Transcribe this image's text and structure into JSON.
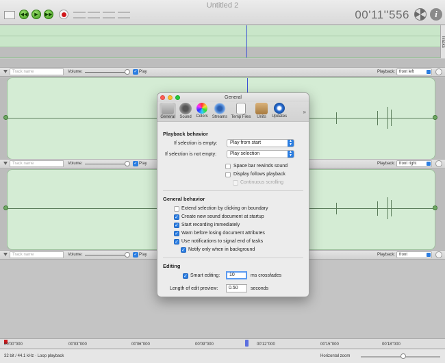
{
  "window": {
    "title": "Untitled 2"
  },
  "toolbar": {
    "timer": "00'11''556"
  },
  "overview": {
    "tracks_tab": "Tracks"
  },
  "tracks": [
    {
      "name_placeholder": "Track name",
      "volume_label": "Volume:",
      "play_label": "Play",
      "playback_label": "Playback:",
      "playback_value": "front left"
    },
    {
      "name_placeholder": "Track name",
      "volume_label": "Volume:",
      "play_label": "Play",
      "playback_label": "Playback:",
      "playback_value": "front right"
    },
    {
      "name_placeholder": "Track name",
      "volume_label": "Volume:",
      "play_label": "Play",
      "playback_label": "Playback:",
      "playback_value": "front"
    }
  ],
  "ruler": {
    "ticks": [
      "00'00''000",
      "00'03''000",
      "00'06''000",
      "00'09''000",
      "00'12''000",
      "00'15''000",
      "00'18''000"
    ]
  },
  "status": {
    "left": "32 bit / 44.1 kHz  ·  Loop playback",
    "zoom_label": "Horizontal zoom"
  },
  "dialog": {
    "title": "General",
    "toolbar": [
      {
        "label": "General",
        "icon": "general-icon"
      },
      {
        "label": "Sound",
        "icon": "speaker-icon"
      },
      {
        "label": "Colors",
        "icon": "color-wheel-icon"
      },
      {
        "label": "Streams",
        "icon": "antenna-icon"
      },
      {
        "label": "Temp Files",
        "icon": "document-clock-icon"
      },
      {
        "label": "Units",
        "icon": "ruler-icon"
      },
      {
        "label": "Updates",
        "icon": "update-icon"
      }
    ],
    "playback": {
      "title": "Playback behavior",
      "empty_label": "If selection is empty:",
      "empty_value": "Play from start",
      "not_empty_label": "If selection is not empty:",
      "not_empty_value": "Play selection",
      "checks": [
        {
          "label": "Space bar rewinds sound",
          "checked": false,
          "disabled": false
        },
        {
          "label": "Display follows playback",
          "checked": false,
          "disabled": false
        },
        {
          "label": "Continuous scrolling",
          "checked": false,
          "disabled": true
        }
      ]
    },
    "general": {
      "title": "General behavior",
      "checks": [
        {
          "label": "Extend selection by clicking on boundary",
          "checked": false
        },
        {
          "label": "Create new sound document at startup",
          "checked": true
        },
        {
          "label": "Start recording immediately",
          "checked": true
        },
        {
          "label": "Warn before losing document attributes",
          "checked": true
        },
        {
          "label": "Use notifications to signal end of tasks",
          "checked": true
        },
        {
          "label": "Notify only when in background",
          "checked": true
        }
      ]
    },
    "editing": {
      "title": "Editing",
      "smart_label": "Smart editing:",
      "smart_checked": true,
      "smart_value": "10",
      "smart_unit": "ms crossfades",
      "preview_label": "Length of edit preview:",
      "preview_value": "0.50",
      "preview_unit": "seconds"
    }
  },
  "colors": {
    "accent": "#2a7de1",
    "waveform_bg": "#d4ecd4",
    "cursor": "#3e53d6"
  }
}
